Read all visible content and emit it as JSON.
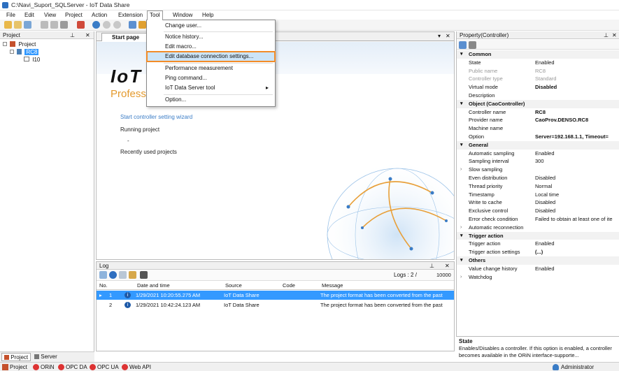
{
  "window": {
    "title": "C:\\Navi_Suport_SQLServer - IoT Data Share"
  },
  "menubar": [
    "File",
    "Edit",
    "View",
    "Project",
    "Action",
    "Extension",
    "Tool",
    "Window",
    "Help"
  ],
  "tool_menu": {
    "items": [
      "Change user...",
      "Notice history...",
      "Edit macro...",
      "Edit database connection settings...",
      "Performance measurement",
      "Ping command...",
      "IoT Data Server tool",
      "Option..."
    ],
    "submenu_arrow": "▸"
  },
  "project_panel": {
    "title": "Project",
    "tree": [
      "Project",
      "RC8",
      "I10"
    ]
  },
  "start_page": {
    "tab": "Start page",
    "close": "✕",
    "banner_big": "IoT",
    "banner_sub": "Profess",
    "wizard_link": "Start controller setting wizard",
    "running_label": "Running project",
    "running_value": "-",
    "recent_label": "Recently used projects"
  },
  "log": {
    "title": "Log",
    "logs_label": "Logs :",
    "logs_count": "2",
    "logs_sep": "/",
    "logs_max": "10000",
    "headers": [
      "No.",
      "Date and time",
      "Source",
      "Code",
      "Message"
    ],
    "rows": [
      {
        "no": "1",
        "time": "1/29/2021 10:20:55.275 AM",
        "source": "IoT Data Share",
        "code": "",
        "message": "The project format has been converted from the past"
      },
      {
        "no": "2",
        "time": "1/29/2021 10:42:24.123 AM",
        "source": "IoT Data Share",
        "code": "",
        "message": "The project format has been converted from the past"
      }
    ]
  },
  "property": {
    "title": "Property(Controller)",
    "rows": [
      {
        "k": "Common",
        "cat": true
      },
      {
        "k": "State",
        "v": "Enabled"
      },
      {
        "k": "Public name",
        "v": "RC8",
        "gray": true
      },
      {
        "k": "Controller type",
        "v": "Standard",
        "gray": true
      },
      {
        "k": "Virtual mode",
        "v": "Disabled",
        "bold": true
      },
      {
        "k": "Description",
        "v": ""
      },
      {
        "k": "Object (CaoController)",
        "cat": true
      },
      {
        "k": "Controller name",
        "v": "RC8",
        "bold": true
      },
      {
        "k": "Provider name",
        "v": "CaoProv.DENSO.RC8",
        "bold": true
      },
      {
        "k": "Machine name",
        "v": ""
      },
      {
        "k": "Option",
        "v": "Server=192.168.1.1, Timeout=",
        "bold": true
      },
      {
        "k": "General",
        "cat": true
      },
      {
        "k": "Automatic sampling",
        "v": "Enabled"
      },
      {
        "k": "Sampling interval",
        "v": "300"
      },
      {
        "k": "Slow sampling",
        "v": "",
        "exp": true
      },
      {
        "k": "Even distribution",
        "v": "Disabled"
      },
      {
        "k": "Thread priority",
        "v": "Normal"
      },
      {
        "k": "Timestamp",
        "v": "Local time"
      },
      {
        "k": "Write to cache",
        "v": "Disabled"
      },
      {
        "k": "Exclusive control",
        "v": "Disabled"
      },
      {
        "k": "Error check condition",
        "v": "Failed to obtain at least one of ite"
      },
      {
        "k": "Automatic reconnection",
        "v": "",
        "exp": true
      },
      {
        "k": "Trigger action",
        "cat": true
      },
      {
        "k": "Trigger action",
        "v": "Enabled"
      },
      {
        "k": "Trigger action settings",
        "v": "(...)",
        "bold": true
      },
      {
        "k": "Others",
        "cat": true
      },
      {
        "k": "Value change history",
        "v": "Enabled"
      },
      {
        "k": "Watchdog",
        "v": "",
        "exp": true
      }
    ],
    "desc_title": "State",
    "desc_text": "Enables/Disables a controller. If this option is enabled, a controller becomes available in the ORiN interface-supporte..."
  },
  "bottom_tabs": [
    "Project",
    "Server"
  ],
  "status": {
    "items": [
      "Project",
      "ORiN",
      "OPC DA",
      "OPC UA",
      "Web API"
    ],
    "user": "Administrator"
  },
  "colors": {
    "accent": "#f28c28",
    "selection": "#3399ff",
    "menu_highlight": "#cce4f7"
  }
}
